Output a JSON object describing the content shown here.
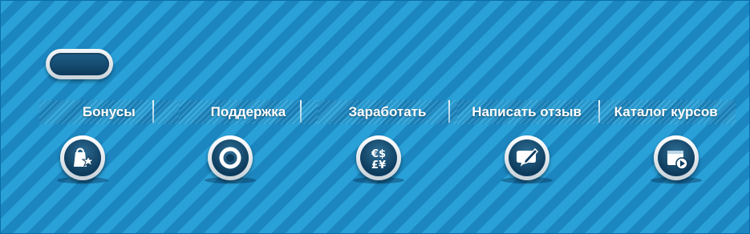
{
  "nav": {
    "items": [
      {
        "label": "Бонусы",
        "icon": "gift-bag-icon"
      },
      {
        "label": "Поддержка",
        "icon": "lifebuoy-icon"
      },
      {
        "label": "Заработать",
        "icon": "currency-icon"
      },
      {
        "label": "Написать отзыв",
        "icon": "write-review-icon"
      },
      {
        "label": "Каталог курсов",
        "icon": "course-catalog-icon"
      }
    ]
  },
  "currency_glyphs": {
    "top": "€$",
    "bottom": "£¥"
  },
  "colors": {
    "background_light": "#2aa0d8",
    "background_dark": "#1b86bf",
    "icon_disc": "#0d3b5c",
    "label": "#ffffff"
  }
}
